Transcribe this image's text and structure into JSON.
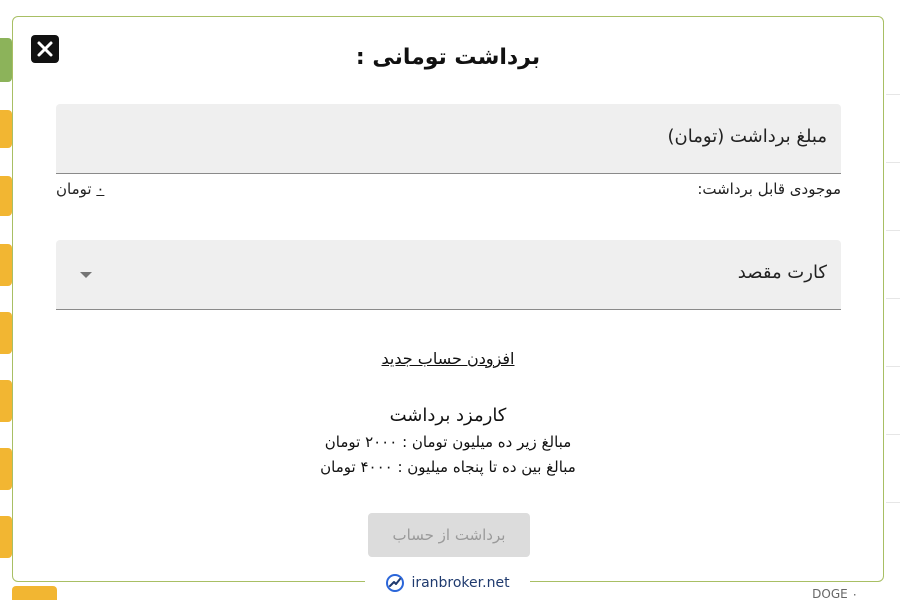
{
  "modal": {
    "title": "برداشت تومانی :",
    "amount_field_label": "مبلغ برداشت (تومان)",
    "balance_label": "موجودی قابل برداشت:",
    "balance_value": "۰",
    "balance_unit": "تومان",
    "card_field_label": "کارت مقصد",
    "add_account_link": "افزودن حساب جدید",
    "fee_title": "کارمزد برداشت",
    "fee_line_1": "مبالغ زیر ده میلیون تومان : ۲۰۰۰ تومان",
    "fee_line_2": "مبالغ بین ده تا پنجاه میلیون : ۴۰۰۰ تومان",
    "withdraw_button": "برداشت از حساب"
  },
  "background": {
    "doge_label": "DOGE ۰"
  },
  "watermark": {
    "text": "iranbroker.net"
  },
  "colors": {
    "modal_border": "#a8bf64",
    "accent_yellow": "#f2b632",
    "accent_green": "#8cb35a",
    "button_disabled_bg": "#dcdcdc"
  },
  "icons": {
    "close": "close-icon",
    "dropdown": "chevron-down-icon",
    "logo": "trend-logo-icon"
  }
}
